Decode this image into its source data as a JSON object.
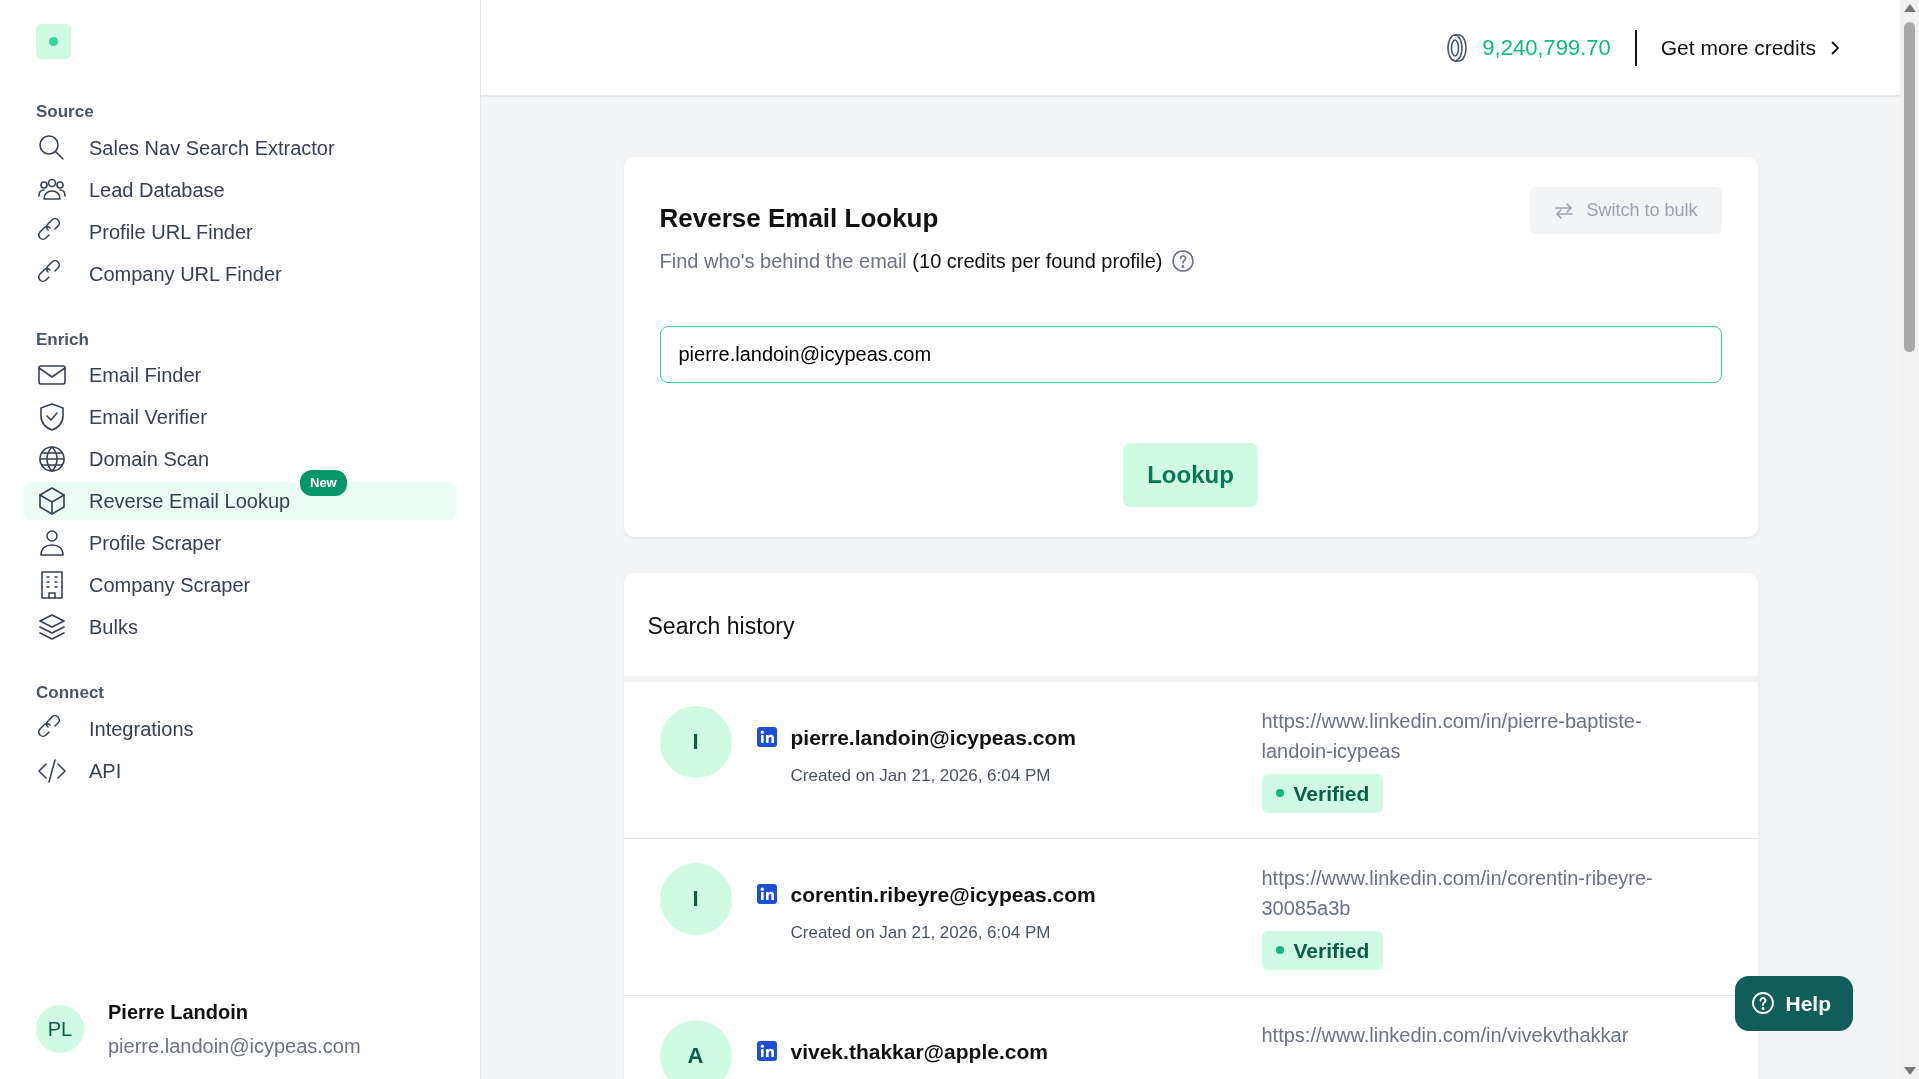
{
  "sidebar": {
    "sections": [
      {
        "title": "Source",
        "items": [
          {
            "label": "Sales Nav Search Extractor",
            "selected": false
          },
          {
            "label": "Lead Database",
            "selected": false
          },
          {
            "label": "Profile URL Finder",
            "selected": false
          },
          {
            "label": "Company URL Finder",
            "selected": false
          }
        ]
      },
      {
        "title": "Enrich",
        "items": [
          {
            "label": "Email Finder",
            "selected": false
          },
          {
            "label": "Email Verifier",
            "selected": false
          },
          {
            "label": "Domain Scan",
            "selected": false
          },
          {
            "label": "Reverse Email Lookup",
            "selected": true,
            "badge": "New"
          },
          {
            "label": "Profile Scraper",
            "selected": false
          },
          {
            "label": "Company Scraper",
            "selected": false
          },
          {
            "label": "Bulks",
            "selected": false
          }
        ]
      },
      {
        "title": "Connect",
        "items": [
          {
            "label": "Integrations",
            "selected": false
          },
          {
            "label": "API",
            "selected": false
          }
        ]
      }
    ],
    "user": {
      "initials": "PL",
      "name": "Pierre Landoin",
      "email": "pierre.landoin@icypeas.com"
    }
  },
  "topbar": {
    "credits": "9,240,799.70",
    "link": "Get more credits"
  },
  "lookup": {
    "title": "Reverse Email Lookup",
    "subtitle": "Find who's behind the email",
    "cost": "(10 credits per found profile)",
    "switch_button": {
      "label": "Switch to bulk",
      "disabled": true
    },
    "input_value": "pierre.landoin@icypeas.com",
    "button": "Lookup"
  },
  "history": {
    "title": "Search history",
    "rows": [
      {
        "initial": "I",
        "email": "pierre.landoin@icypeas.com",
        "created": "Created on Jan 21, 2026, 6:04 PM",
        "url": "https://www.linkedin.com/in/pierre-baptiste-landoin-icypeas",
        "status": "Verified"
      },
      {
        "initial": "I",
        "email": "corentin.ribeyre@icypeas.com",
        "created": "Created on Jan 21, 2026, 6:04 PM",
        "url": "https://www.linkedin.com/in/corentin-ribeyre-30085a3b",
        "status": "Verified"
      },
      {
        "initial": "A",
        "email": "vivek.thakkar@apple.com",
        "url": "https://www.linkedin.com/in/vivekvthakkar"
      }
    ]
  },
  "help": "Help"
}
